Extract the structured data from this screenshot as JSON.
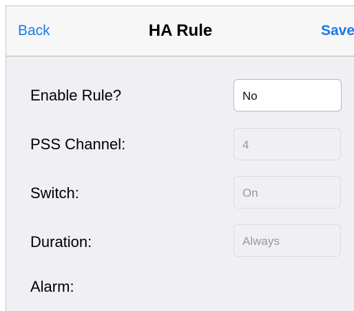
{
  "navbar": {
    "back_label": "Back",
    "title": "HA Rule",
    "save_label": "Save"
  },
  "form": {
    "enable_rule": {
      "label": "Enable Rule?",
      "value": "No"
    },
    "pss_channel": {
      "label": "PSS Channel:",
      "value": "4"
    },
    "switch": {
      "label": "Switch:",
      "value": "On"
    },
    "duration": {
      "label": "Duration:",
      "value": "Always"
    },
    "alarm": {
      "label": "Alarm:"
    }
  },
  "colors": {
    "accent": "#1a7be5",
    "background": "#efeff4",
    "navbar": "#f7f7f7"
  }
}
